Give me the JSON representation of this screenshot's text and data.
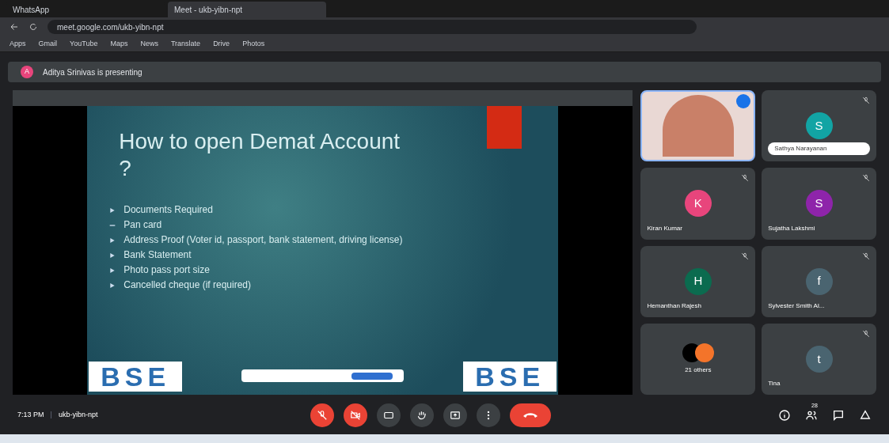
{
  "browser": {
    "tabs": [
      {
        "title": "WhatsApp",
        "selected": false
      },
      {
        "title": "Meet - ukb-yibn-npt",
        "selected": true
      }
    ],
    "address": "meet.google.com/ukb-yibn-npt",
    "bookmarks": [
      "Apps",
      "Gmail",
      "YouTube",
      "Maps",
      "News",
      "Translate",
      "Drive",
      "Photos"
    ]
  },
  "presenting_banner": {
    "avatar": "A",
    "text": "Aditya Srinivas is presenting"
  },
  "slide": {
    "title": "How to open Demat Account ?",
    "bullets": [
      {
        "text": "Documents Required",
        "kind": "arrow"
      },
      {
        "text": "Pan card",
        "kind": "dash"
      },
      {
        "text": "Address Proof (Voter id, passport, bank statement, driving license)",
        "kind": "arrow"
      },
      {
        "text": "Bank Statement",
        "kind": "arrow"
      },
      {
        "text": "Photo pass port size",
        "kind": "arrow"
      },
      {
        "text": "Cancelled cheque (if required)",
        "kind": "arrow"
      }
    ],
    "logo_left": "BSE",
    "logo_right": "BSE"
  },
  "tiles": [
    {
      "kind": "video"
    },
    {
      "kind": "avatar",
      "letter": "S",
      "color": "#12a4a4",
      "name": "Sathya Narayanan",
      "muted": true,
      "pill": true
    },
    {
      "kind": "avatar",
      "letter": "K",
      "color": "#e8457c",
      "name": "Kiran Kumar",
      "muted": true,
      "pill": false
    },
    {
      "kind": "avatar",
      "letter": "S",
      "color": "#8e24aa",
      "name": "Sujatha Lakshmi",
      "muted": true,
      "pill": false
    },
    {
      "kind": "avatar",
      "letter": "H",
      "color": "#0b6b4f",
      "name": "Hemanthan Rajesh",
      "muted": true,
      "pill": false
    },
    {
      "kind": "avatar",
      "letter": "f",
      "color": "#4a6470",
      "name": "Sylvester Smith Al...",
      "muted": true,
      "pill": false
    },
    {
      "kind": "others",
      "name": "21 others"
    },
    {
      "kind": "avatar",
      "letter": "t",
      "color": "#4a6470",
      "name": "Tina",
      "muted": true,
      "pill": false
    }
  ],
  "controls": {
    "time": "7:13 PM",
    "separator": "|",
    "meeting_code": "ukb-yibn-npt",
    "people_count": "28"
  }
}
